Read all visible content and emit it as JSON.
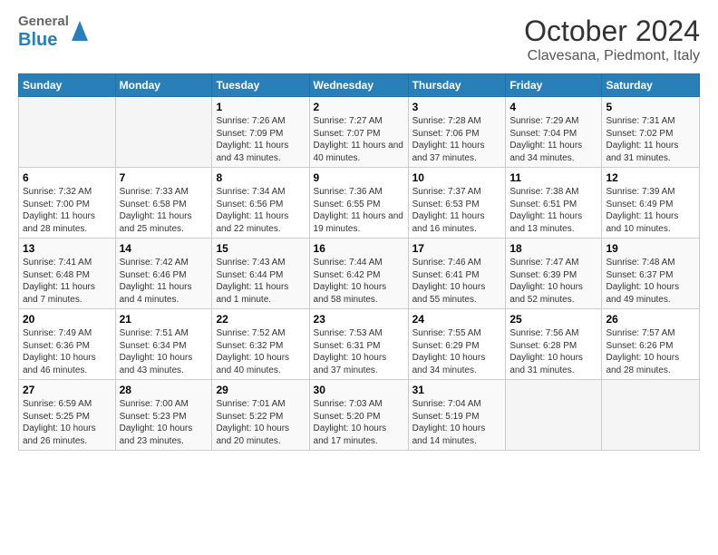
{
  "header": {
    "logo_general": "General",
    "logo_blue": "Blue",
    "title": "October 2024",
    "subtitle": "Clavesana, Piedmont, Italy"
  },
  "days_of_week": [
    "Sunday",
    "Monday",
    "Tuesday",
    "Wednesday",
    "Thursday",
    "Friday",
    "Saturday"
  ],
  "weeks": [
    [
      {
        "day": "",
        "sunrise": "",
        "sunset": "",
        "daylight": ""
      },
      {
        "day": "",
        "sunrise": "",
        "sunset": "",
        "daylight": ""
      },
      {
        "day": "1",
        "sunrise": "Sunrise: 7:26 AM",
        "sunset": "Sunset: 7:09 PM",
        "daylight": "Daylight: 11 hours and 43 minutes."
      },
      {
        "day": "2",
        "sunrise": "Sunrise: 7:27 AM",
        "sunset": "Sunset: 7:07 PM",
        "daylight": "Daylight: 11 hours and 40 minutes."
      },
      {
        "day": "3",
        "sunrise": "Sunrise: 7:28 AM",
        "sunset": "Sunset: 7:06 PM",
        "daylight": "Daylight: 11 hours and 37 minutes."
      },
      {
        "day": "4",
        "sunrise": "Sunrise: 7:29 AM",
        "sunset": "Sunset: 7:04 PM",
        "daylight": "Daylight: 11 hours and 34 minutes."
      },
      {
        "day": "5",
        "sunrise": "Sunrise: 7:31 AM",
        "sunset": "Sunset: 7:02 PM",
        "daylight": "Daylight: 11 hours and 31 minutes."
      }
    ],
    [
      {
        "day": "6",
        "sunrise": "Sunrise: 7:32 AM",
        "sunset": "Sunset: 7:00 PM",
        "daylight": "Daylight: 11 hours and 28 minutes."
      },
      {
        "day": "7",
        "sunrise": "Sunrise: 7:33 AM",
        "sunset": "Sunset: 6:58 PM",
        "daylight": "Daylight: 11 hours and 25 minutes."
      },
      {
        "day": "8",
        "sunrise": "Sunrise: 7:34 AM",
        "sunset": "Sunset: 6:56 PM",
        "daylight": "Daylight: 11 hours and 22 minutes."
      },
      {
        "day": "9",
        "sunrise": "Sunrise: 7:36 AM",
        "sunset": "Sunset: 6:55 PM",
        "daylight": "Daylight: 11 hours and 19 minutes."
      },
      {
        "day": "10",
        "sunrise": "Sunrise: 7:37 AM",
        "sunset": "Sunset: 6:53 PM",
        "daylight": "Daylight: 11 hours and 16 minutes."
      },
      {
        "day": "11",
        "sunrise": "Sunrise: 7:38 AM",
        "sunset": "Sunset: 6:51 PM",
        "daylight": "Daylight: 11 hours and 13 minutes."
      },
      {
        "day": "12",
        "sunrise": "Sunrise: 7:39 AM",
        "sunset": "Sunset: 6:49 PM",
        "daylight": "Daylight: 11 hours and 10 minutes."
      }
    ],
    [
      {
        "day": "13",
        "sunrise": "Sunrise: 7:41 AM",
        "sunset": "Sunset: 6:48 PM",
        "daylight": "Daylight: 11 hours and 7 minutes."
      },
      {
        "day": "14",
        "sunrise": "Sunrise: 7:42 AM",
        "sunset": "Sunset: 6:46 PM",
        "daylight": "Daylight: 11 hours and 4 minutes."
      },
      {
        "day": "15",
        "sunrise": "Sunrise: 7:43 AM",
        "sunset": "Sunset: 6:44 PM",
        "daylight": "Daylight: 11 hours and 1 minute."
      },
      {
        "day": "16",
        "sunrise": "Sunrise: 7:44 AM",
        "sunset": "Sunset: 6:42 PM",
        "daylight": "Daylight: 10 hours and 58 minutes."
      },
      {
        "day": "17",
        "sunrise": "Sunrise: 7:46 AM",
        "sunset": "Sunset: 6:41 PM",
        "daylight": "Daylight: 10 hours and 55 minutes."
      },
      {
        "day": "18",
        "sunrise": "Sunrise: 7:47 AM",
        "sunset": "Sunset: 6:39 PM",
        "daylight": "Daylight: 10 hours and 52 minutes."
      },
      {
        "day": "19",
        "sunrise": "Sunrise: 7:48 AM",
        "sunset": "Sunset: 6:37 PM",
        "daylight": "Daylight: 10 hours and 49 minutes."
      }
    ],
    [
      {
        "day": "20",
        "sunrise": "Sunrise: 7:49 AM",
        "sunset": "Sunset: 6:36 PM",
        "daylight": "Daylight: 10 hours and 46 minutes."
      },
      {
        "day": "21",
        "sunrise": "Sunrise: 7:51 AM",
        "sunset": "Sunset: 6:34 PM",
        "daylight": "Daylight: 10 hours and 43 minutes."
      },
      {
        "day": "22",
        "sunrise": "Sunrise: 7:52 AM",
        "sunset": "Sunset: 6:32 PM",
        "daylight": "Daylight: 10 hours and 40 minutes."
      },
      {
        "day": "23",
        "sunrise": "Sunrise: 7:53 AM",
        "sunset": "Sunset: 6:31 PM",
        "daylight": "Daylight: 10 hours and 37 minutes."
      },
      {
        "day": "24",
        "sunrise": "Sunrise: 7:55 AM",
        "sunset": "Sunset: 6:29 PM",
        "daylight": "Daylight: 10 hours and 34 minutes."
      },
      {
        "day": "25",
        "sunrise": "Sunrise: 7:56 AM",
        "sunset": "Sunset: 6:28 PM",
        "daylight": "Daylight: 10 hours and 31 minutes."
      },
      {
        "day": "26",
        "sunrise": "Sunrise: 7:57 AM",
        "sunset": "Sunset: 6:26 PM",
        "daylight": "Daylight: 10 hours and 28 minutes."
      }
    ],
    [
      {
        "day": "27",
        "sunrise": "Sunrise: 6:59 AM",
        "sunset": "Sunset: 5:25 PM",
        "daylight": "Daylight: 10 hours and 26 minutes."
      },
      {
        "day": "28",
        "sunrise": "Sunrise: 7:00 AM",
        "sunset": "Sunset: 5:23 PM",
        "daylight": "Daylight: 10 hours and 23 minutes."
      },
      {
        "day": "29",
        "sunrise": "Sunrise: 7:01 AM",
        "sunset": "Sunset: 5:22 PM",
        "daylight": "Daylight: 10 hours and 20 minutes."
      },
      {
        "day": "30",
        "sunrise": "Sunrise: 7:03 AM",
        "sunset": "Sunset: 5:20 PM",
        "daylight": "Daylight: 10 hours and 17 minutes."
      },
      {
        "day": "31",
        "sunrise": "Sunrise: 7:04 AM",
        "sunset": "Sunset: 5:19 PM",
        "daylight": "Daylight: 10 hours and 14 minutes."
      },
      {
        "day": "",
        "sunrise": "",
        "sunset": "",
        "daylight": ""
      },
      {
        "day": "",
        "sunrise": "",
        "sunset": "",
        "daylight": ""
      }
    ]
  ]
}
